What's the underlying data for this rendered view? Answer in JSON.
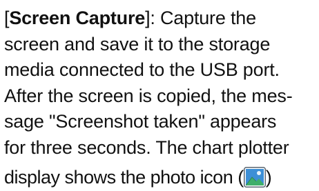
{
  "paragraph": {
    "term_open": "[",
    "term": "Screen Capture",
    "term_close": "]",
    "line1_rest": ": Capture the",
    "line2": "screen and save it to the storage",
    "line3": "media connected to the USB port.",
    "line4": "After the screen is copied, the mes-",
    "line5": "sage \"Screenshot taken\" appears",
    "line6": "for three seconds. The chart plotter",
    "line7_before_icon": "display shows the photo icon (",
    "line7_after_icon": ")",
    "icon": "photo-icon"
  },
  "colors": {
    "text": "#111111",
    "icon_frame": "#5a6570",
    "icon_sky": "#3d8fd6",
    "icon_hill": "#3fae6a"
  }
}
